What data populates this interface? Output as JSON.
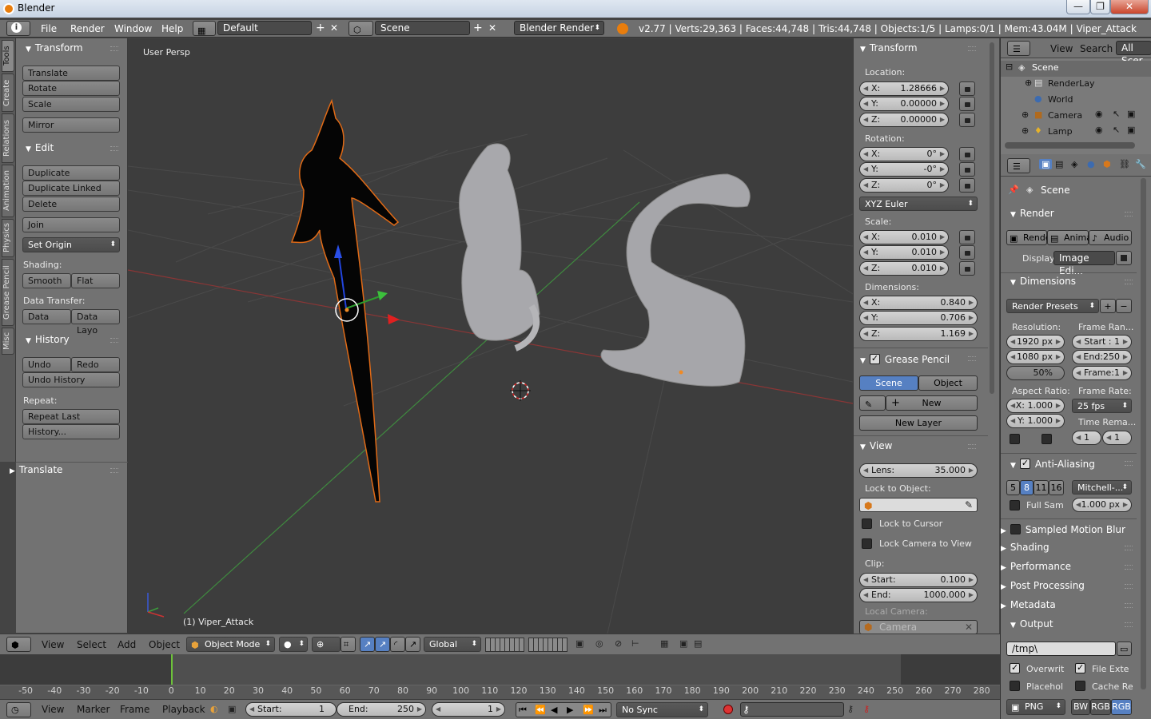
{
  "window": {
    "title": "Blender"
  },
  "menubar": {
    "info_icon": "info-icon",
    "menus": [
      "File",
      "Render",
      "Window",
      "Help"
    ],
    "layout": "Default",
    "scene": "Scene",
    "engine": "Blender Render",
    "stats": "v2.77 | Verts:29,363 | Faces:44,748 | Tris:44,748 | Objects:1/5 | Lamps:0/1 | Mem:43.04M | Viper_Attack"
  },
  "left_tabs": [
    "Tools",
    "Create",
    "Relations",
    "Animation",
    "Physics",
    "Grease Pencil",
    "Misc"
  ],
  "toolshelf": {
    "transform_title": "Transform",
    "translate": "Translate",
    "rotate": "Rotate",
    "scale": "Scale",
    "mirror": "Mirror",
    "edit_title": "Edit",
    "duplicate": "Duplicate",
    "duplicate_linked": "Duplicate Linked",
    "delete": "Delete",
    "join": "Join",
    "set_origin": "Set Origin",
    "shading_label": "Shading:",
    "smooth": "Smooth",
    "flat": "Flat",
    "data_transfer_label": "Data Transfer:",
    "data": "Data",
    "data_layo": "Data Layo",
    "history_title": "History",
    "undo": "Undo",
    "redo": "Redo",
    "undo_history": "Undo History",
    "repeat_label": "Repeat:",
    "repeat_last": "Repeat Last",
    "history_dots": "History...",
    "operator_title": "Translate"
  },
  "viewport": {
    "persp": "User Persp",
    "object": "(1) Viper_Attack"
  },
  "nprops": {
    "transform_title": "Transform",
    "location_label": "Location:",
    "loc_x": "1.28666",
    "loc_y": "0.00000",
    "loc_z": "0.00000",
    "rotation_label": "Rotation:",
    "rot_x": "0°",
    "rot_y": "-0°",
    "rot_z": "0°",
    "rot_mode": "XYZ Euler",
    "scale_label": "Scale:",
    "scale_x": "0.010",
    "scale_y": "0.010",
    "scale_z": "0.010",
    "dimensions_label": "Dimensions:",
    "dim_x": "0.840",
    "dim_y": "0.706",
    "dim_z": "1.169",
    "x": "X:",
    "y": "Y:",
    "z": "Z:",
    "grease_pencil_title": "Grease Pencil",
    "gp_scene": "Scene",
    "gp_object": "Object",
    "gp_new": "New",
    "gp_new_layer": "New Layer",
    "view_title": "View",
    "lens_label": "Lens:",
    "lens": "35.000",
    "lock_to_object": "Lock to Object:",
    "lock_to_cursor": "Lock to Cursor",
    "lock_camera": "Lock Camera to View",
    "clip_label": "Clip:",
    "clip_start_label": "Start:",
    "clip_start": "0.100",
    "clip_end_label": "End:",
    "clip_end": "1000.000",
    "local_camera": "Local Camera:",
    "camera": "Camera"
  },
  "outliner": {
    "view": "View",
    "search": "Search",
    "all_scenes": "All Scer",
    "items": [
      "Scene",
      "RenderLay",
      "World",
      "Camera",
      "Lamp"
    ]
  },
  "rprops": {
    "scene": "Scene",
    "render_title": "Render",
    "render_btn": "Rende",
    "anim_btn": "Anima",
    "audio_btn": "Audio",
    "display_label": "Display:",
    "display": "Image Edi...",
    "dimensions_title": "Dimensions",
    "render_presets": "Render Presets",
    "resolution_label": "Resolution:",
    "res_x": "1920 px",
    "res_y": "1080 px",
    "res_pct": "50%",
    "frame_range_label": "Frame Ran...",
    "frame_start": "Start : 1",
    "frame_end": "End:250",
    "frame_step": "Frame:1",
    "aspect_label": "Aspect Ratio:",
    "aspect_x": "X: 1.000",
    "aspect_y": "Y: 1.000",
    "frame_rate_label": "Frame Rate:",
    "fps": "25 fps",
    "time_remap_label": "Time Rema...",
    "time_old": "1",
    "time_new": "1",
    "aa_title": "Anti-Aliasing",
    "aa_samples": [
      "5",
      "8",
      "11",
      "16"
    ],
    "aa_filter": "Mitchell-...",
    "full_sample": "Full Sam",
    "filter_size": "1.000 px",
    "motion_blur": "Sampled Motion Blur",
    "shading": "Shading",
    "performance": "Performance",
    "post_processing": "Post Processing",
    "metadata": "Metadata",
    "output": "Output",
    "output_path": "/tmp\\",
    "overwrite": "Overwrit",
    "file_ext": "File Exte",
    "placeholders": "Placehol",
    "cache_result": "Cache Re",
    "format": "PNG",
    "bw": "BW",
    "rgb": "RGB",
    "rgba": "RGB"
  },
  "view3d_header": {
    "menus": [
      "View",
      "Select",
      "Add",
      "Object"
    ],
    "mode": "Object Mode",
    "orientation": "Global"
  },
  "timeline": {
    "ticks": [
      "-50",
      "-40",
      "-30",
      "-20",
      "-10",
      "0",
      "10",
      "20",
      "30",
      "40",
      "50",
      "60",
      "70",
      "80",
      "90",
      "100",
      "110",
      "120",
      "130",
      "140",
      "150",
      "160",
      "170",
      "180",
      "190",
      "200",
      "210",
      "220",
      "230",
      "240",
      "250",
      "260",
      "270",
      "280"
    ],
    "current_frame": 1
  },
  "timeline_header": {
    "menus": [
      "View",
      "Marker",
      "Frame",
      "Playback"
    ],
    "start_label": "Start:",
    "start": "1",
    "end_label": "End:",
    "end": "250",
    "current": "1",
    "sync": "No Sync"
  },
  "colors": {
    "accent": "#5680c2",
    "active_orange": "#f08a24",
    "selection": "#e06a16"
  }
}
